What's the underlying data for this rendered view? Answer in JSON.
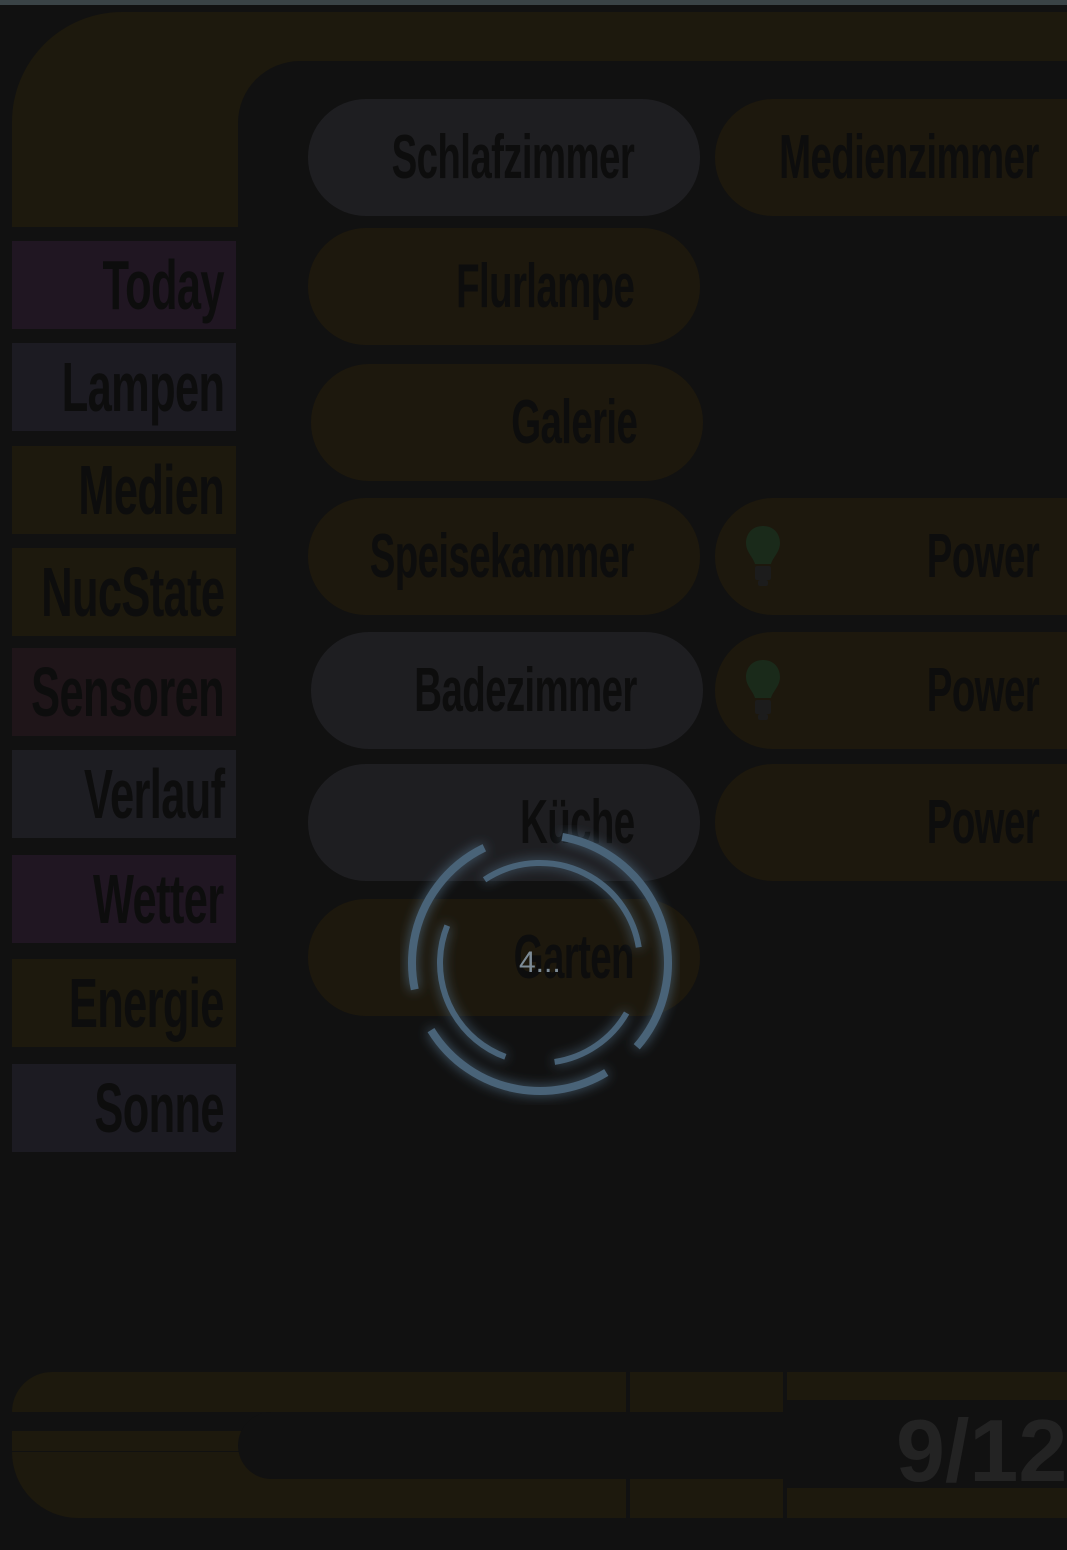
{
  "nav": [
    {
      "label": "Today",
      "color": "#201622"
    },
    {
      "label": "Lampen",
      "color": "#1c1b22"
    },
    {
      "label": "Medien",
      "color": "#1d190d"
    },
    {
      "label": "NucState",
      "color": "#1d190d"
    },
    {
      "label": "Sensoren",
      "color": "#1f1519"
    },
    {
      "label": "Verlauf",
      "color": "#1d1d22"
    },
    {
      "label": "Wetter",
      "color": "#201622"
    },
    {
      "label": "Energie",
      "color": "#1d190d"
    },
    {
      "label": "Sonne",
      "color": "#1c1b22"
    }
  ],
  "rooms": {
    "schlafzimmer": "Schlafzimmer",
    "medienzimmer": "Medienzimmer",
    "flurlampe": "Flurlampe",
    "galerie": "Galerie",
    "speisekammer": "Speisekammer",
    "badezimmer": "Badezimmer",
    "kueche": "Küche",
    "garten": "Garten"
  },
  "power": {
    "row4": "Power",
    "row5": "Power",
    "row6": "Power"
  },
  "icons": {
    "bulb1": "lightbulb-icon",
    "bulb2": "lightbulb-icon"
  },
  "footer": {
    "date": "9/12/"
  },
  "loading": {
    "text": "4..."
  },
  "colors": {
    "amber": "#1d180d",
    "gray": "#1e1e21",
    "background": "#111111",
    "spinner": "#4a6378"
  }
}
